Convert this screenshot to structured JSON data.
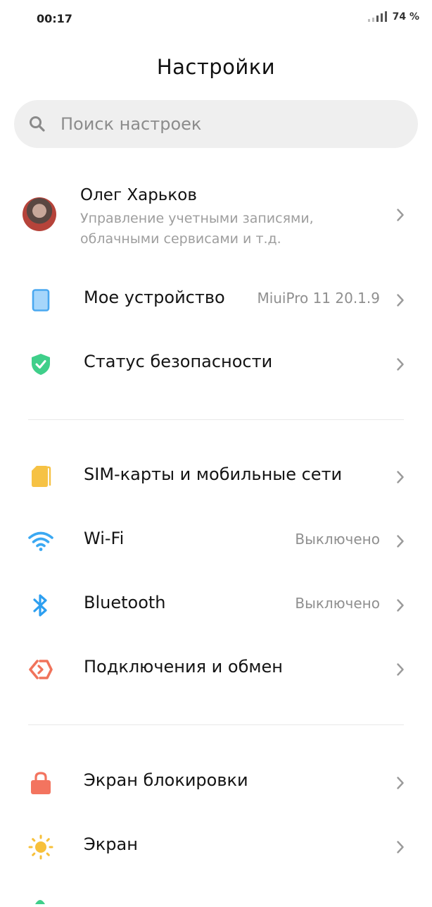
{
  "status_bar": {
    "time": "00:17",
    "battery": "74 %"
  },
  "header": {
    "title": "Настройки"
  },
  "search": {
    "placeholder": "Поиск настроек"
  },
  "account": {
    "name": "Олег Харьков",
    "subtitle": "Управление учетными записями, облачными сервисами и т.д."
  },
  "sections": [
    {
      "items": [
        {
          "label": "Мое устройство",
          "value": "MiuiPro 11 20.1.9",
          "icon": "tablet-icon",
          "color": "#4aa8f0"
        },
        {
          "label": "Статус безопасности",
          "value": "",
          "icon": "shield-check-icon",
          "color": "#3fcf8a"
        }
      ]
    },
    {
      "items": [
        {
          "label": "SIM-карты и мобильные сети",
          "value": "",
          "icon": "sim-card-icon",
          "color": "#f6c244"
        },
        {
          "label": "Wi-Fi",
          "value": "Выключено",
          "icon": "wifi-icon",
          "color": "#3aa8f2"
        },
        {
          "label": "Bluetooth",
          "value": "Выключено",
          "icon": "bluetooth-icon",
          "color": "#2d9ff0"
        },
        {
          "label": "Подключения и обмен",
          "value": "",
          "icon": "share-connection-icon",
          "color": "#f0735b"
        }
      ]
    },
    {
      "items": [
        {
          "label": "Экран блокировки",
          "value": "",
          "icon": "lock-icon",
          "color": "#f3745f"
        },
        {
          "label": "Экран",
          "value": "",
          "icon": "sun-icon",
          "color": "#f7c03a"
        }
      ]
    }
  ]
}
